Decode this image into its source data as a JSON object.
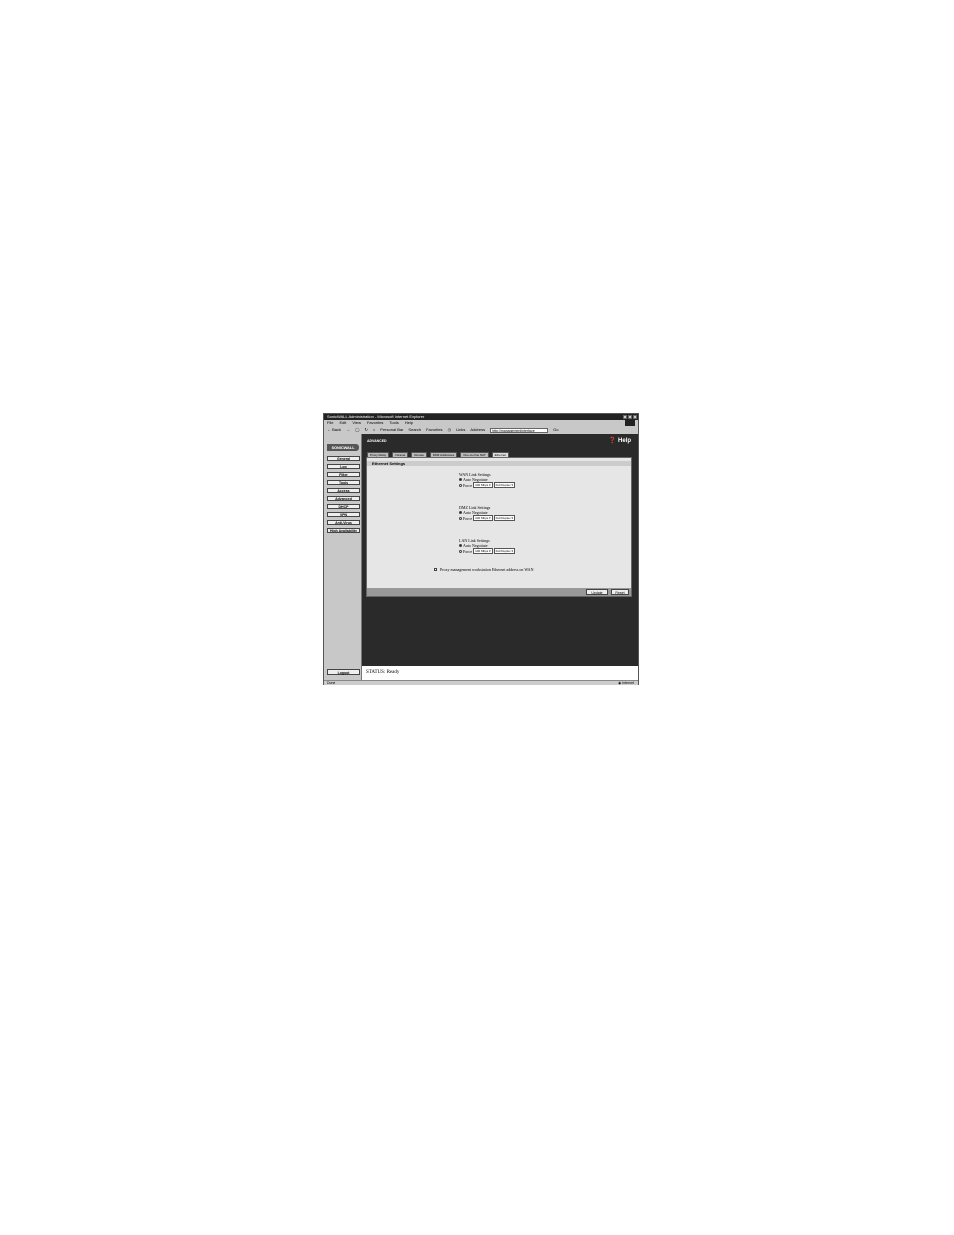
{
  "window": {
    "title": "SonicWALL Administration - Microsoft Internet Explorer",
    "menu": [
      "File",
      "Edit",
      "View",
      "Favorites",
      "Tools",
      "Help"
    ],
    "toolbar": {
      "back": "Back",
      "personal_bar": "Personal Bar",
      "search": "Search",
      "favorites": "Favorites",
      "links": "Links",
      "address_label": "Address",
      "address_value": "http://managementinterface",
      "go": "Go"
    },
    "status_left": "Done",
    "status_zone": "Internet"
  },
  "sidebar": {
    "logo": "SONICWALL",
    "items": [
      "General",
      "Log",
      "Filter",
      "Tools",
      "Access",
      "Advanced",
      "DHCP",
      "VPN",
      "Anti-Virus",
      "High Availability"
    ],
    "logout": "Logout"
  },
  "main": {
    "section": "ADVANCED",
    "help": "Help",
    "tabs": [
      "Proxy Relay",
      "Intranet",
      "Routes",
      "DMZ Addresses",
      "One-to-One NAT",
      "Ethernet"
    ],
    "active_tab": "Ethernet",
    "panel_title": "Ethernet Settings",
    "groups": [
      {
        "title": "WAN Link Settings",
        "auto": "Auto Negotiate",
        "force": "Force",
        "speed": "100 Mbps",
        "duplex": "Full Duplex"
      },
      {
        "title": "DMZ Link Settings",
        "auto": "Auto Negotiate",
        "force": "Force",
        "speed": "100 Mbps",
        "duplex": "Full Duplex"
      },
      {
        "title": "LAN Link Settings",
        "auto": "Auto Negotiate",
        "force": "Force",
        "speed": "100 Mbps",
        "duplex": "Full Duplex"
      }
    ],
    "proxy_label": "Proxy management workstation Ethernet address on WAN",
    "update_button": "Update",
    "reset_button": "Reset",
    "status_text": "STATUS: Ready"
  }
}
